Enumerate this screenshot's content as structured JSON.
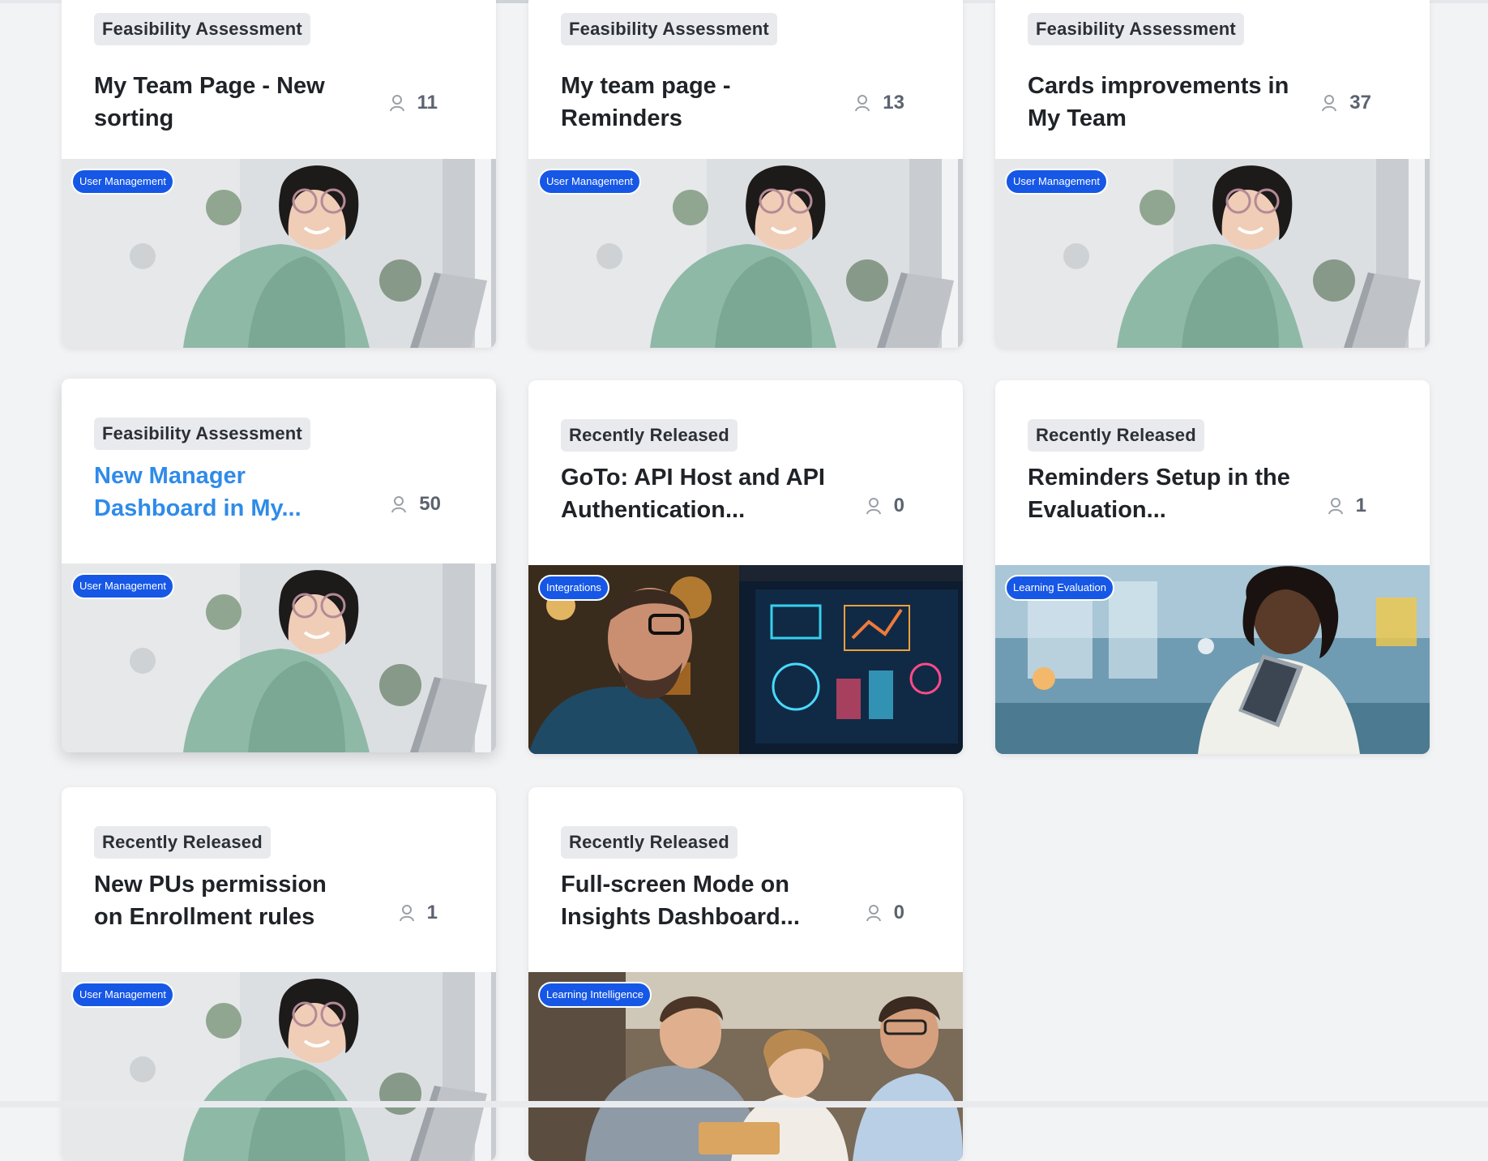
{
  "cards": [
    {
      "status": "Feasibility Assessment",
      "title": "My Team Page - New sorting",
      "followers": "11",
      "category": "User Management",
      "image": "woman-laptop"
    },
    {
      "status": "Feasibility Assessment",
      "title": "My team page - Reminders",
      "followers": "13",
      "category": "User Management",
      "image": "woman-laptop"
    },
    {
      "status": "Feasibility Assessment",
      "title": "Cards improvements in My Team",
      "followers": "37",
      "category": "User Management",
      "image": "woman-laptop"
    },
    {
      "status": "Feasibility Assessment",
      "title": "New Manager Dashboard in My...",
      "followers": "50",
      "category": "User Management",
      "image": "woman-laptop"
    },
    {
      "status": "Recently Released",
      "title": "GoTo: API Host and API Authentication...",
      "followers": "0",
      "category": "Integrations",
      "image": "man-dashboard-screen"
    },
    {
      "status": "Recently Released",
      "title": "Reminders Setup in the Evaluation...",
      "followers": "1",
      "category": "Learning Evaluation",
      "image": "woman-tablet"
    },
    {
      "status": "Recently Released",
      "title": "New PUs permission on Enrollment rules",
      "followers": "1",
      "category": "User Management",
      "image": "woman-laptop"
    },
    {
      "status": "Recently Released",
      "title": "Full-screen Mode on Insights Dashboard...",
      "followers": "0",
      "category": "Learning Intelligence",
      "image": "team-meeting"
    }
  ],
  "icons": {
    "followers": "person-icon"
  },
  "colors": {
    "category_pill": "#1657e6",
    "link_title": "#2f8be8",
    "status_tag_bg": "#e9eaed"
  }
}
